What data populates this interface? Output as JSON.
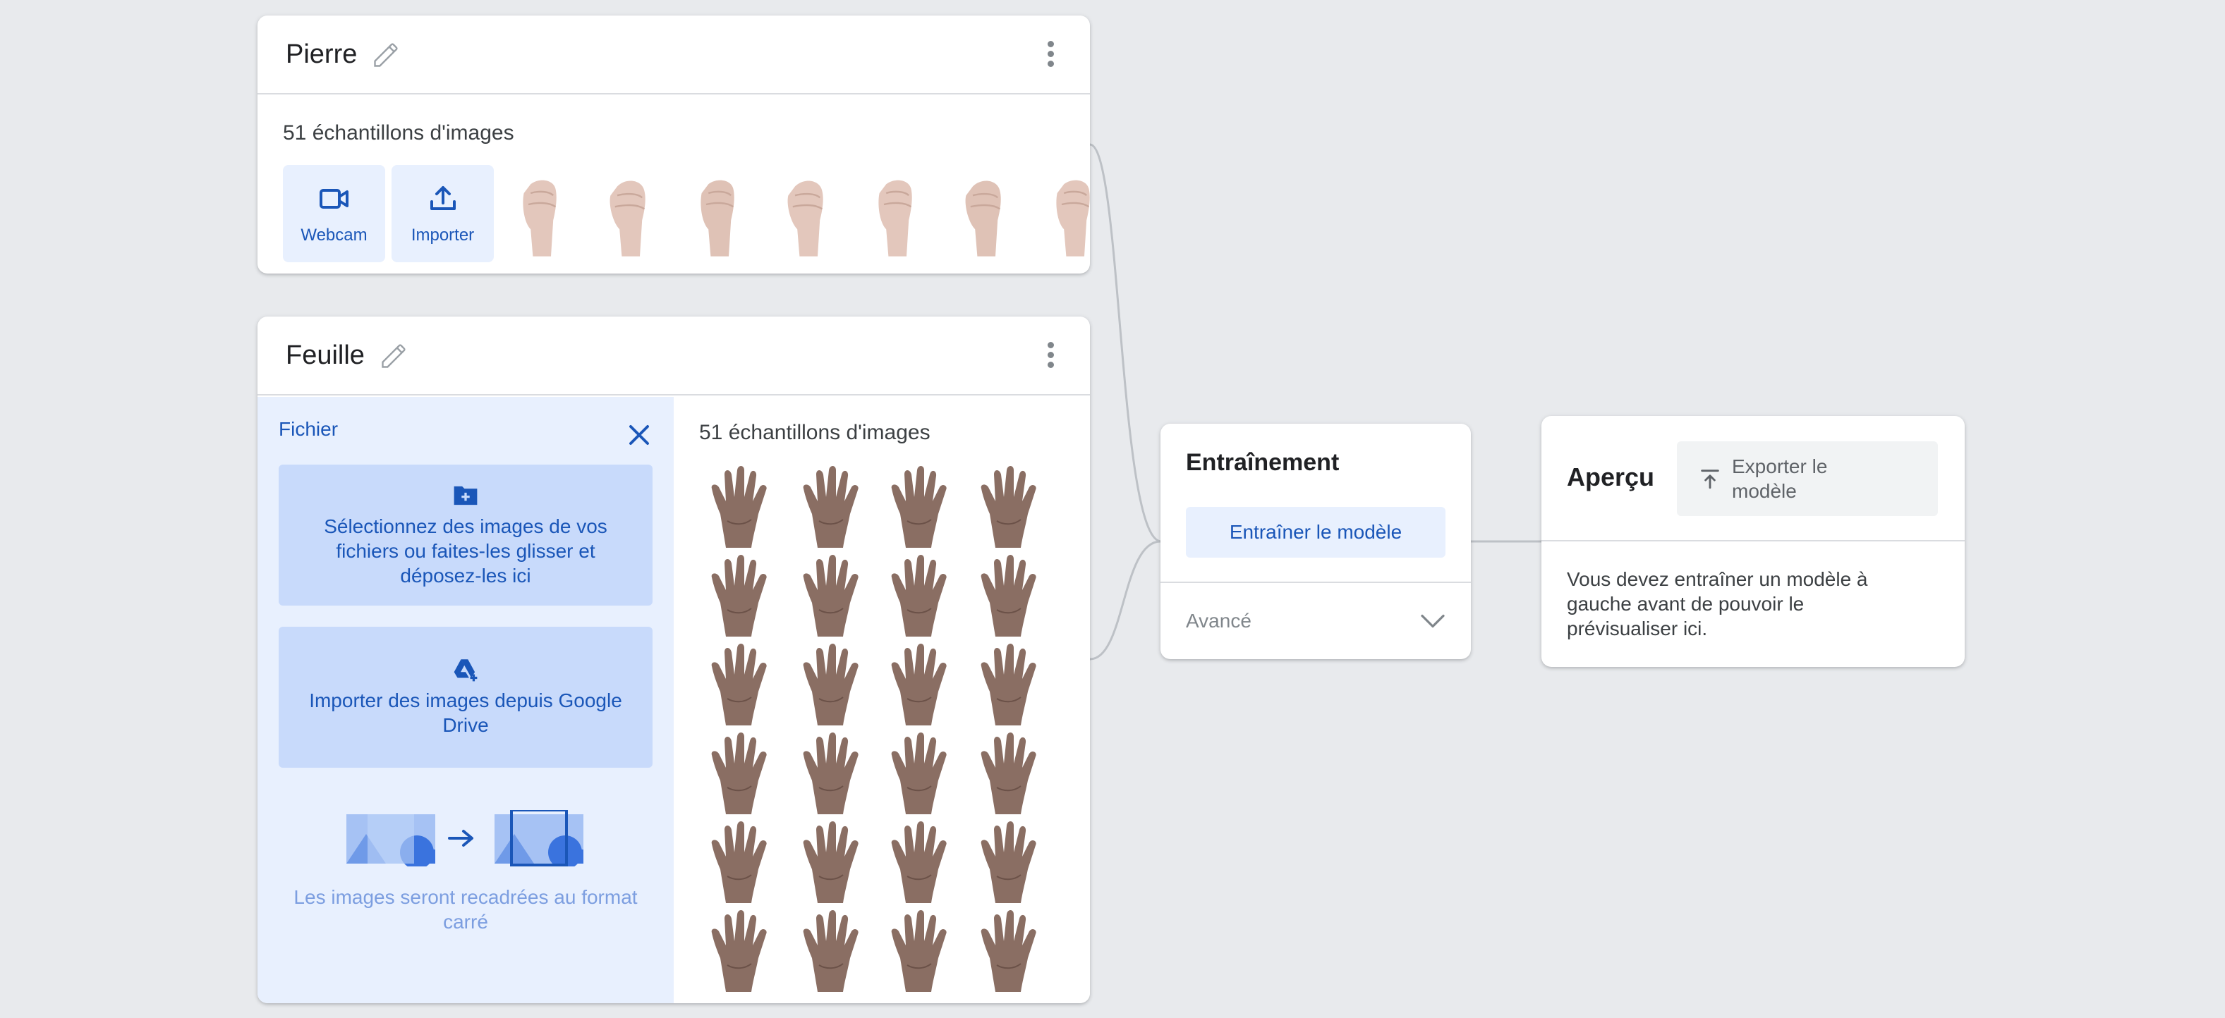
{
  "classes": [
    {
      "name": "Pierre",
      "samples_label": "51 échantillons d'images",
      "webcam_label": "Webcam",
      "upload_label": "Importer"
    },
    {
      "name": "Feuille",
      "samples_label": "51 échantillons d'images",
      "upload_panel": {
        "title": "Fichier",
        "file_drop_text": "Sélectionnez des images de vos fichiers ou faites-les glisser et déposez-les ici",
        "drive_text": "Importer des images depuis Google Drive",
        "crop_note": "Les images seront recadrées au format carré"
      }
    }
  ],
  "training": {
    "title": "Entraînement",
    "train_button": "Entraîner le modèle",
    "advanced_label": "Avancé"
  },
  "preview": {
    "title": "Aperçu",
    "export_button": "Exporter le modèle",
    "message": "Vous devez entraîner un modèle à gauche avant de pouvoir le prévisualiser ici."
  },
  "colors": {
    "background": "#e8eaed",
    "accent": "#1a56b8",
    "accent_light": "#e8f0fe",
    "drop_box": "#c8dafb"
  }
}
